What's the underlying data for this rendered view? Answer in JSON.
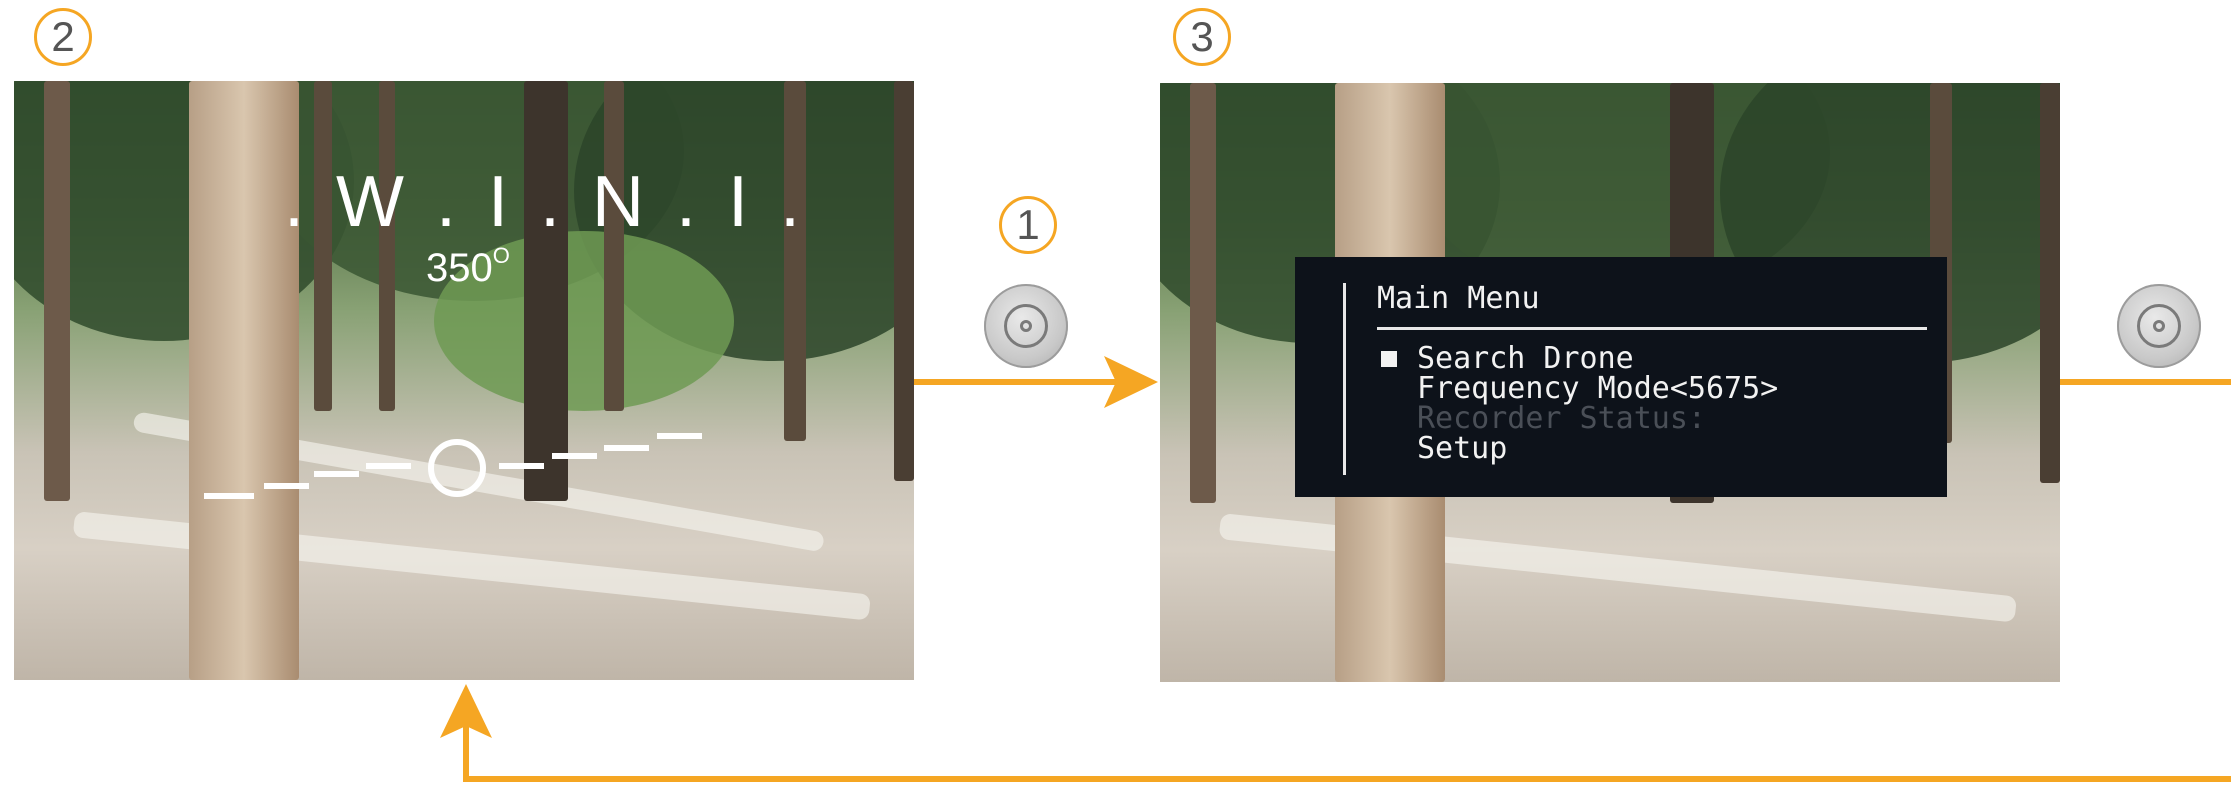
{
  "badges": {
    "step1": "1",
    "step2": "2",
    "step3": "3"
  },
  "compass": {
    "letters": ". W . I . N . I .",
    "heading_value": "350",
    "heading_unit": "O"
  },
  "menu": {
    "title": "Main Menu",
    "items": [
      {
        "label": "Search Drone",
        "selected": true,
        "enabled": true
      },
      {
        "label": "Frequency Mode<5675>",
        "selected": false,
        "enabled": true
      },
      {
        "label": "Recorder Status:",
        "selected": false,
        "enabled": false
      },
      {
        "label": "Setup",
        "selected": false,
        "enabled": true
      }
    ]
  },
  "buttons": {
    "press_icon": "push-button-icon"
  },
  "colors": {
    "accent": "#f5a623",
    "menu_bg": "#0d121a",
    "badge_text": "#555555"
  }
}
